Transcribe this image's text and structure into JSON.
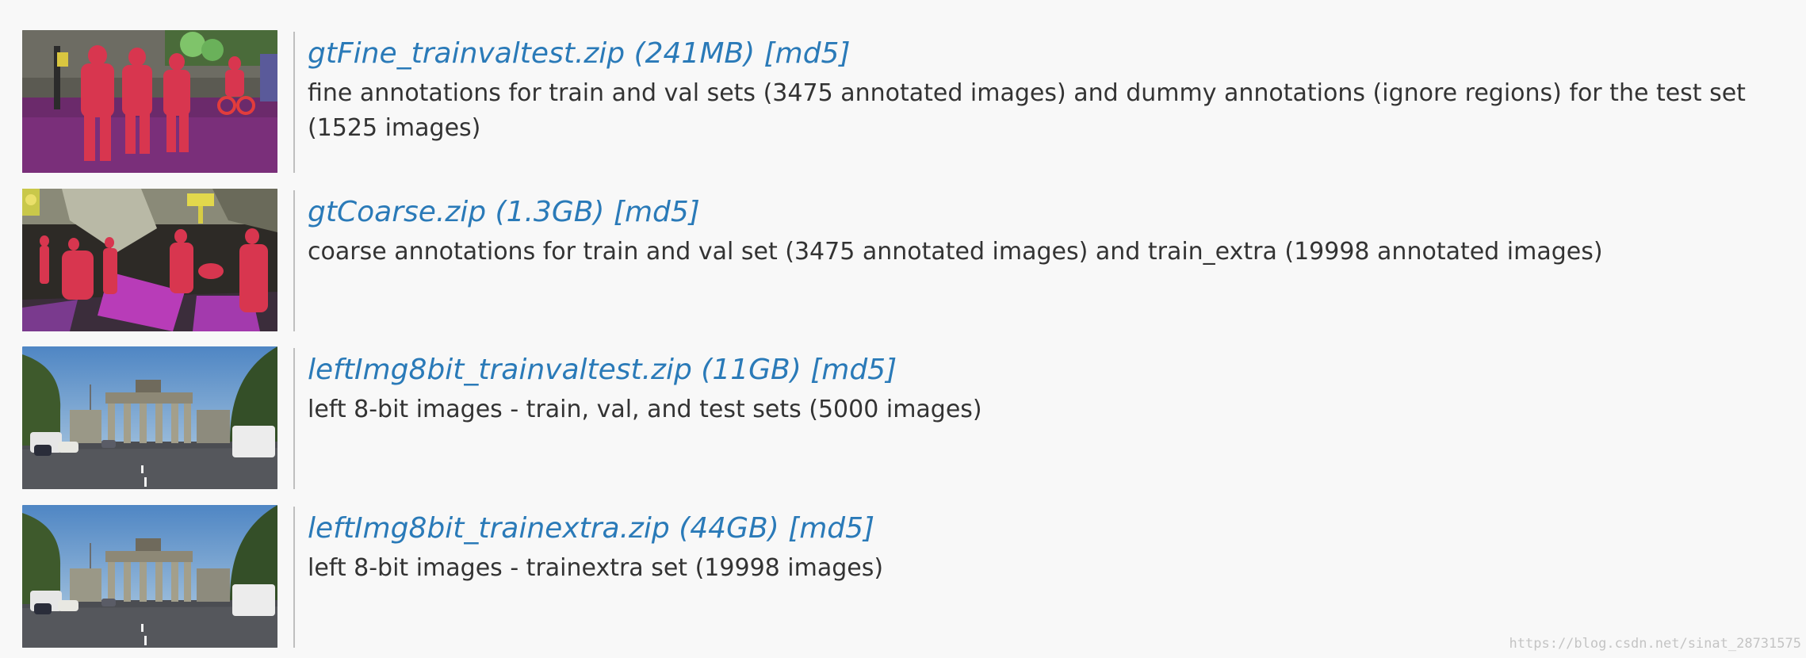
{
  "downloads": [
    {
      "title": "gtFine_trainvaltest.zip (241MB) [md5]",
      "description": "fine annotations for train and val sets (3475 annotated images) and dummy annotations (ignore regions) for the test set (1525 images)",
      "thumbnail": "segmentation-fine-thumbnail"
    },
    {
      "title": "gtCoarse.zip (1.3GB) [md5]",
      "description": "coarse annotations for train and val set (3475 annotated images) and train_extra (19998 annotated images)",
      "thumbnail": "segmentation-coarse-thumbnail"
    },
    {
      "title": "leftImg8bit_trainvaltest.zip (11GB) [md5]",
      "description": "left 8-bit images - train, val, and test sets (5000 images)",
      "thumbnail": "brandenburg-gate-photo"
    },
    {
      "title": "leftImg8bit_trainextra.zip (44GB) [md5]",
      "description": "left 8-bit images - trainextra set (19998 images)",
      "thumbnail": "brandenburg-gate-photo"
    }
  ],
  "watermark": "https://blog.csdn.net/sinat_28731575",
  "colors": {
    "link": "#2a7ab8",
    "text": "#333333",
    "background": "#f8f8f8",
    "divider": "#bfbfbf"
  }
}
